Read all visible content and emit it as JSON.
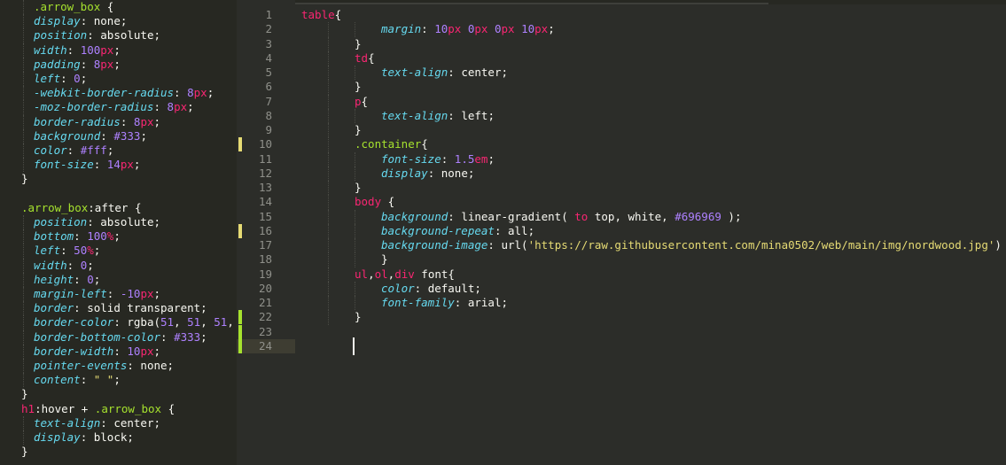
{
  "left_panel": {
    "lines": [
      {
        "indent": 1,
        "tokens": [
          {
            "t": ".arrow_box",
            "c": "sel"
          },
          {
            "t": " {",
            "c": "punc"
          }
        ]
      },
      {
        "indent": 1,
        "tokens": [
          {
            "t": "display",
            "c": "prop"
          },
          {
            "t": ": ",
            "c": "punc"
          },
          {
            "t": "none",
            "c": "val"
          },
          {
            "t": ";",
            "c": "punc"
          }
        ]
      },
      {
        "indent": 1,
        "tokens": [
          {
            "t": "position",
            "c": "prop"
          },
          {
            "t": ": ",
            "c": "punc"
          },
          {
            "t": "absolute",
            "c": "val"
          },
          {
            "t": ";",
            "c": "punc"
          }
        ]
      },
      {
        "indent": 1,
        "tokens": [
          {
            "t": "width",
            "c": "prop"
          },
          {
            "t": ": ",
            "c": "punc"
          },
          {
            "t": "100",
            "c": "num"
          },
          {
            "t": "px",
            "c": "unit"
          },
          {
            "t": ";",
            "c": "punc"
          }
        ]
      },
      {
        "indent": 1,
        "tokens": [
          {
            "t": "padding",
            "c": "prop"
          },
          {
            "t": ": ",
            "c": "punc"
          },
          {
            "t": "8",
            "c": "num"
          },
          {
            "t": "px",
            "c": "unit"
          },
          {
            "t": ";",
            "c": "punc"
          }
        ]
      },
      {
        "indent": 1,
        "tokens": [
          {
            "t": "left",
            "c": "prop"
          },
          {
            "t": ": ",
            "c": "punc"
          },
          {
            "t": "0",
            "c": "num"
          },
          {
            "t": ";",
            "c": "punc"
          }
        ]
      },
      {
        "indent": 1,
        "tokens": [
          {
            "t": "-webkit-border-radius",
            "c": "prop"
          },
          {
            "t": ": ",
            "c": "punc"
          },
          {
            "t": "8",
            "c": "num"
          },
          {
            "t": "px",
            "c": "unit"
          },
          {
            "t": ";",
            "c": "punc"
          }
        ]
      },
      {
        "indent": 1,
        "tokens": [
          {
            "t": "-moz-border-radius",
            "c": "prop"
          },
          {
            "t": ": ",
            "c": "punc"
          },
          {
            "t": "8",
            "c": "num"
          },
          {
            "t": "px",
            "c": "unit"
          },
          {
            "t": ";",
            "c": "punc"
          }
        ]
      },
      {
        "indent": 1,
        "tokens": [
          {
            "t": "border-radius",
            "c": "prop"
          },
          {
            "t": ": ",
            "c": "punc"
          },
          {
            "t": "8",
            "c": "num"
          },
          {
            "t": "px",
            "c": "unit"
          },
          {
            "t": ";",
            "c": "punc"
          }
        ]
      },
      {
        "indent": 1,
        "tokens": [
          {
            "t": "background",
            "c": "prop"
          },
          {
            "t": ": ",
            "c": "punc"
          },
          {
            "t": "#333",
            "c": "num"
          },
          {
            "t": ";",
            "c": "punc"
          }
        ]
      },
      {
        "indent": 1,
        "tokens": [
          {
            "t": "color",
            "c": "prop"
          },
          {
            "t": ": ",
            "c": "punc"
          },
          {
            "t": "#fff",
            "c": "num"
          },
          {
            "t": ";",
            "c": "punc"
          }
        ]
      },
      {
        "indent": 1,
        "tokens": [
          {
            "t": "font-size",
            "c": "prop"
          },
          {
            "t": ": ",
            "c": "punc"
          },
          {
            "t": "14",
            "c": "num"
          },
          {
            "t": "px",
            "c": "unit"
          },
          {
            "t": ";",
            "c": "punc"
          }
        ]
      },
      {
        "indent": 0,
        "tokens": [
          {
            "t": "}",
            "c": "punc"
          }
        ]
      },
      {
        "indent": 0,
        "tokens": []
      },
      {
        "indent": 0,
        "tokens": [
          {
            "t": ".arrow_box",
            "c": "sel"
          },
          {
            "t": ":after {",
            "c": "punc"
          }
        ]
      },
      {
        "indent": 1,
        "tokens": [
          {
            "t": "position",
            "c": "prop"
          },
          {
            "t": ": ",
            "c": "punc"
          },
          {
            "t": "absolute",
            "c": "val"
          },
          {
            "t": ";",
            "c": "punc"
          }
        ]
      },
      {
        "indent": 1,
        "tokens": [
          {
            "t": "bottom",
            "c": "prop"
          },
          {
            "t": ": ",
            "c": "punc"
          },
          {
            "t": "100",
            "c": "num"
          },
          {
            "t": "%",
            "c": "unit"
          },
          {
            "t": ";",
            "c": "punc"
          }
        ]
      },
      {
        "indent": 1,
        "tokens": [
          {
            "t": "left",
            "c": "prop"
          },
          {
            "t": ": ",
            "c": "punc"
          },
          {
            "t": "50",
            "c": "num"
          },
          {
            "t": "%",
            "c": "unit"
          },
          {
            "t": ";",
            "c": "punc"
          }
        ]
      },
      {
        "indent": 1,
        "tokens": [
          {
            "t": "width",
            "c": "prop"
          },
          {
            "t": ": ",
            "c": "punc"
          },
          {
            "t": "0",
            "c": "num"
          },
          {
            "t": ";",
            "c": "punc"
          }
        ]
      },
      {
        "indent": 1,
        "tokens": [
          {
            "t": "height",
            "c": "prop"
          },
          {
            "t": ": ",
            "c": "punc"
          },
          {
            "t": "0",
            "c": "num"
          },
          {
            "t": ";",
            "c": "punc"
          }
        ]
      },
      {
        "indent": 1,
        "tokens": [
          {
            "t": "margin-left",
            "c": "prop"
          },
          {
            "t": ": ",
            "c": "punc"
          },
          {
            "t": "-10",
            "c": "num"
          },
          {
            "t": "px",
            "c": "unit"
          },
          {
            "t": ";",
            "c": "punc"
          }
        ]
      },
      {
        "indent": 1,
        "tokens": [
          {
            "t": "border",
            "c": "prop"
          },
          {
            "t": ": ",
            "c": "punc"
          },
          {
            "t": "solid transparent",
            "c": "val"
          },
          {
            "t": ";",
            "c": "punc"
          }
        ]
      },
      {
        "indent": 1,
        "tokens": [
          {
            "t": "border-color",
            "c": "prop"
          },
          {
            "t": ": ",
            "c": "punc"
          },
          {
            "t": "rgba(",
            "c": "val"
          },
          {
            "t": "51",
            "c": "num"
          },
          {
            "t": ", ",
            "c": "punc"
          },
          {
            "t": "51",
            "c": "num"
          },
          {
            "t": ", ",
            "c": "punc"
          },
          {
            "t": "51",
            "c": "num"
          },
          {
            "t": ",",
            "c": "punc"
          }
        ]
      },
      {
        "indent": 1,
        "tokens": [
          {
            "t": "border-bottom-color",
            "c": "prop"
          },
          {
            "t": ": ",
            "c": "punc"
          },
          {
            "t": "#333",
            "c": "num"
          },
          {
            "t": ";",
            "c": "punc"
          }
        ]
      },
      {
        "indent": 1,
        "tokens": [
          {
            "t": "border-width",
            "c": "prop"
          },
          {
            "t": ": ",
            "c": "punc"
          },
          {
            "t": "10",
            "c": "num"
          },
          {
            "t": "px",
            "c": "unit"
          },
          {
            "t": ";",
            "c": "punc"
          }
        ]
      },
      {
        "indent": 1,
        "tokens": [
          {
            "t": "pointer-events",
            "c": "prop"
          },
          {
            "t": ": ",
            "c": "punc"
          },
          {
            "t": "none",
            "c": "val"
          },
          {
            "t": ";",
            "c": "punc"
          }
        ]
      },
      {
        "indent": 1,
        "tokens": [
          {
            "t": "content",
            "c": "prop"
          },
          {
            "t": ": ",
            "c": "punc"
          },
          {
            "t": "\" \"",
            "c": "str"
          },
          {
            "t": ";",
            "c": "punc"
          }
        ]
      },
      {
        "indent": 0,
        "tokens": [
          {
            "t": "}",
            "c": "punc"
          }
        ]
      },
      {
        "indent": 0,
        "tokens": [
          {
            "t": "h1",
            "c": "tag"
          },
          {
            "t": ":hover + ",
            "c": "punc"
          },
          {
            "t": ".arrow_box",
            "c": "sel"
          },
          {
            "t": " {",
            "c": "punc"
          }
        ]
      },
      {
        "indent": 1,
        "tokens": [
          {
            "t": "text-align",
            "c": "prop"
          },
          {
            "t": ": ",
            "c": "punc"
          },
          {
            "t": "center",
            "c": "val"
          },
          {
            "t": ";",
            "c": "punc"
          }
        ]
      },
      {
        "indent": 1,
        "tokens": [
          {
            "t": "display",
            "c": "prop"
          },
          {
            "t": ": ",
            "c": "punc"
          },
          {
            "t": "block",
            "c": "val"
          },
          {
            "t": ";",
            "c": "punc"
          }
        ]
      },
      {
        "indent": 0,
        "tokens": [
          {
            "t": "}",
            "c": "punc"
          }
        ]
      }
    ]
  },
  "editor": {
    "current_line": 24,
    "lines": [
      {
        "n": "1",
        "indent": 0,
        "mark": "",
        "tokens": [
          {
            "t": "table",
            "c": "tag"
          },
          {
            "t": "{",
            "c": "punc"
          }
        ]
      },
      {
        "n": "2",
        "indent": 3,
        "mark": "",
        "tokens": [
          {
            "t": "margin",
            "c": "prop"
          },
          {
            "t": ": ",
            "c": "punc"
          },
          {
            "t": "10",
            "c": "num"
          },
          {
            "t": "px ",
            "c": "unit"
          },
          {
            "t": "0",
            "c": "num"
          },
          {
            "t": "px ",
            "c": "unit"
          },
          {
            "t": "0",
            "c": "num"
          },
          {
            "t": "px ",
            "c": "unit"
          },
          {
            "t": "10",
            "c": "num"
          },
          {
            "t": "px",
            "c": "unit"
          },
          {
            "t": ";",
            "c": "punc"
          }
        ]
      },
      {
        "n": "3",
        "indent": 2,
        "mark": "",
        "tokens": [
          {
            "t": "}",
            "c": "punc"
          }
        ]
      },
      {
        "n": "4",
        "indent": 2,
        "mark": "",
        "tokens": [
          {
            "t": "td",
            "c": "tag"
          },
          {
            "t": "{",
            "c": "punc"
          }
        ]
      },
      {
        "n": "5",
        "indent": 3,
        "mark": "",
        "tokens": [
          {
            "t": "text-align",
            "c": "prop"
          },
          {
            "t": ": ",
            "c": "punc"
          },
          {
            "t": "center",
            "c": "val"
          },
          {
            "t": ";",
            "c": "punc"
          }
        ]
      },
      {
        "n": "6",
        "indent": 2,
        "mark": "",
        "tokens": [
          {
            "t": "}",
            "c": "punc"
          }
        ]
      },
      {
        "n": "7",
        "indent": 2,
        "mark": "",
        "tokens": [
          {
            "t": "p",
            "c": "tag"
          },
          {
            "t": "{",
            "c": "punc"
          }
        ]
      },
      {
        "n": "8",
        "indent": 3,
        "mark": "",
        "tokens": [
          {
            "t": "text-align",
            "c": "prop"
          },
          {
            "t": ": ",
            "c": "punc"
          },
          {
            "t": "left",
            "c": "val"
          },
          {
            "t": ";",
            "c": "punc"
          }
        ]
      },
      {
        "n": "9",
        "indent": 2,
        "mark": "",
        "tokens": [
          {
            "t": "}",
            "c": "punc"
          }
        ]
      },
      {
        "n": "10",
        "indent": 2,
        "mark": "mod",
        "tokens": [
          {
            "t": ".container",
            "c": "sel"
          },
          {
            "t": "{",
            "c": "punc"
          }
        ]
      },
      {
        "n": "11",
        "indent": 3,
        "mark": "",
        "tokens": [
          {
            "t": "font-size",
            "c": "prop"
          },
          {
            "t": ": ",
            "c": "punc"
          },
          {
            "t": "1.5",
            "c": "num"
          },
          {
            "t": "em",
            "c": "unit"
          },
          {
            "t": ";",
            "c": "punc"
          }
        ]
      },
      {
        "n": "12",
        "indent": 3,
        "mark": "",
        "tokens": [
          {
            "t": "display",
            "c": "prop"
          },
          {
            "t": ": ",
            "c": "punc"
          },
          {
            "t": "none",
            "c": "val"
          },
          {
            "t": ";",
            "c": "punc"
          }
        ]
      },
      {
        "n": "13",
        "indent": 2,
        "mark": "",
        "tokens": [
          {
            "t": "}",
            "c": "punc"
          }
        ]
      },
      {
        "n": "14",
        "indent": 2,
        "mark": "",
        "tokens": [
          {
            "t": "body",
            "c": "tag"
          },
          {
            "t": " {",
            "c": "punc"
          }
        ]
      },
      {
        "n": "15",
        "indent": 3,
        "mark": "",
        "tokens": [
          {
            "t": "background",
            "c": "prop"
          },
          {
            "t": ": ",
            "c": "punc"
          },
          {
            "t": "linear-gradient(",
            "c": "val"
          },
          {
            "t": " to",
            "c": "kw"
          },
          {
            "t": " top",
            "c": "val"
          },
          {
            "t": ", ",
            "c": "punc"
          },
          {
            "t": "white",
            "c": "val"
          },
          {
            "t": ", ",
            "c": "punc"
          },
          {
            "t": "#696969",
            "c": "num"
          },
          {
            "t": " );",
            "c": "punc"
          }
        ]
      },
      {
        "n": "16",
        "indent": 3,
        "mark": "mod",
        "tokens": [
          {
            "t": "background-repeat",
            "c": "prop"
          },
          {
            "t": ": ",
            "c": "punc"
          },
          {
            "t": "all",
            "c": "val"
          },
          {
            "t": ";",
            "c": "punc"
          }
        ]
      },
      {
        "n": "17",
        "indent": 3,
        "mark": "",
        "tokens": [
          {
            "t": "background-image",
            "c": "prop"
          },
          {
            "t": ": ",
            "c": "punc"
          },
          {
            "t": "url(",
            "c": "val"
          },
          {
            "t": "'https://raw.githubusercontent.com/mina0502/web/main/img/nordwood.jpg'",
            "c": "str"
          },
          {
            "t": ")",
            "c": "punc"
          }
        ]
      },
      {
        "n": "18",
        "indent": 3,
        "mark": "",
        "tokens": [
          {
            "t": "}",
            "c": "punc"
          }
        ]
      },
      {
        "n": "19",
        "indent": 2,
        "mark": "",
        "tokens": [
          {
            "t": "ul",
            "c": "tag"
          },
          {
            "t": ",",
            "c": "punc"
          },
          {
            "t": "ol",
            "c": "tag"
          },
          {
            "t": ",",
            "c": "punc"
          },
          {
            "t": "div",
            "c": "tag"
          },
          {
            "t": " font{",
            "c": "punc"
          }
        ]
      },
      {
        "n": "20",
        "indent": 3,
        "mark": "",
        "tokens": [
          {
            "t": "color",
            "c": "prop"
          },
          {
            "t": ": ",
            "c": "punc"
          },
          {
            "t": "default",
            "c": "val"
          },
          {
            "t": ";",
            "c": "punc"
          }
        ]
      },
      {
        "n": "21",
        "indent": 3,
        "mark": "",
        "tokens": [
          {
            "t": "font-family",
            "c": "prop"
          },
          {
            "t": ": ",
            "c": "punc"
          },
          {
            "t": "arial",
            "c": "val"
          },
          {
            "t": ";",
            "c": "punc"
          }
        ]
      },
      {
        "n": "22",
        "indent": 2,
        "mark": "add",
        "tokens": [
          {
            "t": "}",
            "c": "punc"
          }
        ]
      },
      {
        "n": "23",
        "indent": 0,
        "mark": "add",
        "tokens": []
      },
      {
        "n": "24",
        "indent": 0,
        "mark": "add",
        "tokens": []
      }
    ]
  }
}
